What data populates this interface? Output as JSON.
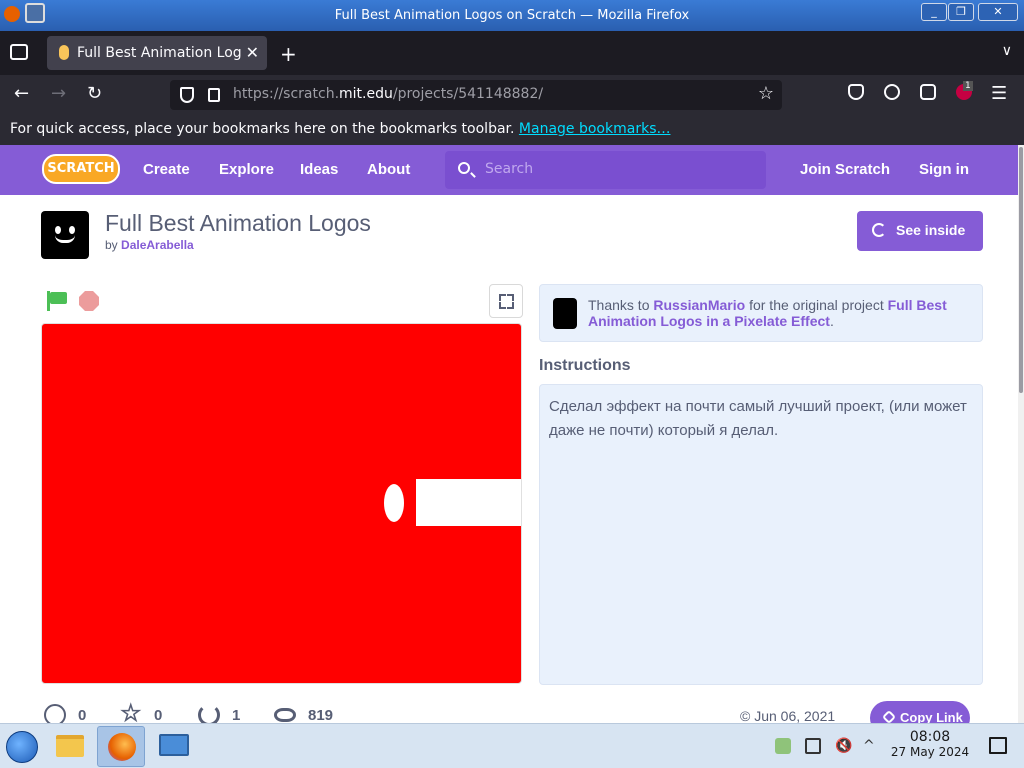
{
  "window": {
    "title": "Full Best Animation Logos on Scratch — Mozilla Firefox",
    "controls": [
      "_",
      "❐",
      "✕"
    ]
  },
  "tab": {
    "label": "Full Best Animation Logos on Scratch",
    "close": "✕",
    "new_tab": "+"
  },
  "nav": {
    "back": "←",
    "forward": "→",
    "reload": "↻",
    "url_prefix": "https://scratch.",
    "url_host": "mit.edu",
    "url_path": "/projects/541148882/",
    "bookmark_star": "☆",
    "menu": "☰",
    "ext_badge": "1"
  },
  "bookmarks_bar": {
    "text": "For quick access, place your bookmarks here on the bookmarks toolbar.",
    "link": "Manage bookmarks…"
  },
  "scratch_nav": {
    "logo": "SCRATCH",
    "links": [
      "Create",
      "Explore",
      "Ideas",
      "About"
    ],
    "search_placeholder": "Search",
    "join": "Join Scratch",
    "signin": "Sign in"
  },
  "project": {
    "title": "Full Best Animation Logos",
    "by_label": "by",
    "author": "DaleArabella",
    "see_inside": "See inside"
  },
  "remix": {
    "thanks_to": "Thanks to",
    "original_author": "RussianMario",
    "mid_text": "for the original project",
    "original_project": "Full Best Animation Logos in a Pixelate Effect",
    "end": "."
  },
  "instructions": {
    "heading": "Instructions",
    "text": "Сделал эффект на почти самый лучший проект, (или может даже не почти) который я делал."
  },
  "stats": {
    "loves": "0",
    "favorites": "0",
    "remixes": "1",
    "views": "819",
    "date": "© Jun 06, 2021",
    "copy_link": "Copy Link"
  },
  "taskbar": {
    "time": "08:08",
    "date": "27 May 2024",
    "tray_up": "^"
  },
  "colors": {
    "scratch_purple": "#855cd6",
    "stage_red": "#ff0000",
    "panel_blue": "#e9f1fc"
  }
}
